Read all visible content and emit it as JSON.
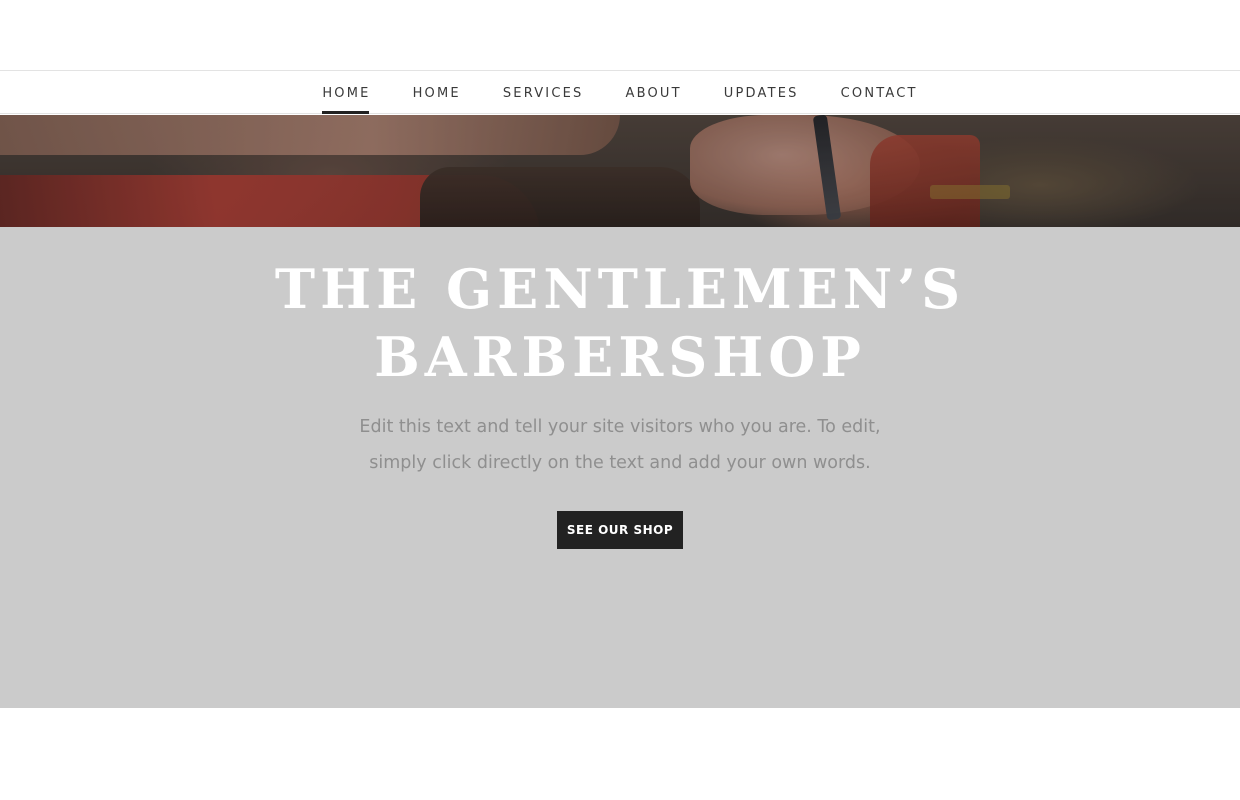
{
  "nav": {
    "items": [
      {
        "label": "HOME"
      },
      {
        "label": "HOME"
      },
      {
        "label": "SERVICES"
      },
      {
        "label": "ABOUT"
      },
      {
        "label": "UPDATES"
      },
      {
        "label": "CONTACT"
      }
    ],
    "active_index": 0
  },
  "hero": {
    "title_line1": "THE GENTLEMEN’S",
    "title_line2": "BARBERSHOP",
    "body": "Edit this text and tell your site visitors who you are. To edit, simply click directly on the text and add your own words.",
    "button_label": "SEE OUR SHOP"
  },
  "colors": {
    "hero_background": "#cbcbcb",
    "button_background": "#222222",
    "active_underline": "#222222",
    "nav_text": "#3a3a3a",
    "body_text": "#8f8f8f"
  }
}
